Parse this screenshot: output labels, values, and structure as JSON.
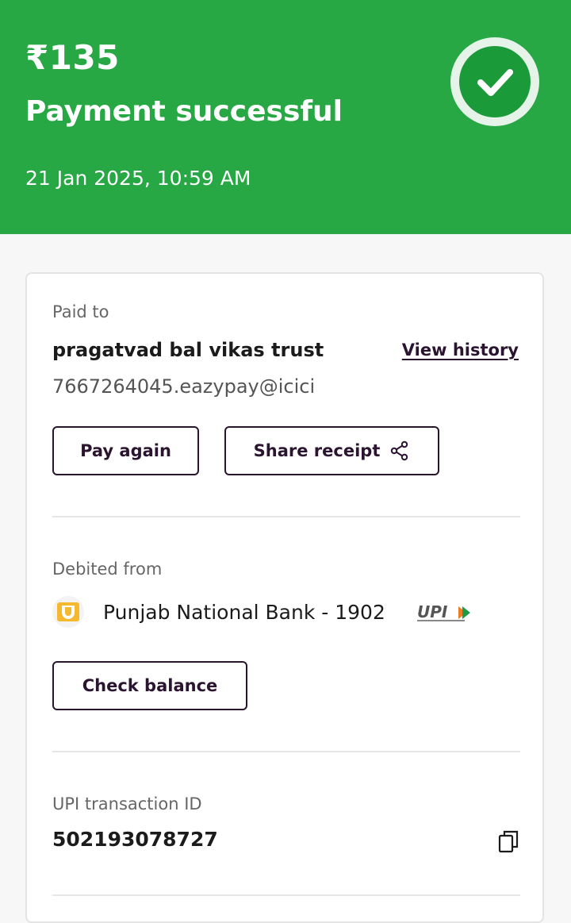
{
  "header": {
    "amount": "₹135",
    "status": "Payment successful",
    "datetime": "21 Jan 2025, 10:59 AM"
  },
  "paid_to": {
    "label": "Paid to",
    "name": "pragatvad bal vikas trust",
    "upi_id": "7667264045.eazypay@icici",
    "view_history": "View history",
    "pay_again": "Pay again",
    "share_receipt": "Share receipt"
  },
  "debited_from": {
    "label": "Debited from",
    "bank": "Punjab National Bank - 1902",
    "check_balance": "Check balance"
  },
  "transaction": {
    "label": "UPI transaction ID",
    "id": "502193078727"
  },
  "colors": {
    "header_green": "#27a844",
    "check_green": "#1b9a3a",
    "button_border": "#2b1430"
  },
  "icons": [
    "check-icon",
    "share-icon",
    "pnb-logo",
    "upi-logo",
    "copy-icon"
  ]
}
